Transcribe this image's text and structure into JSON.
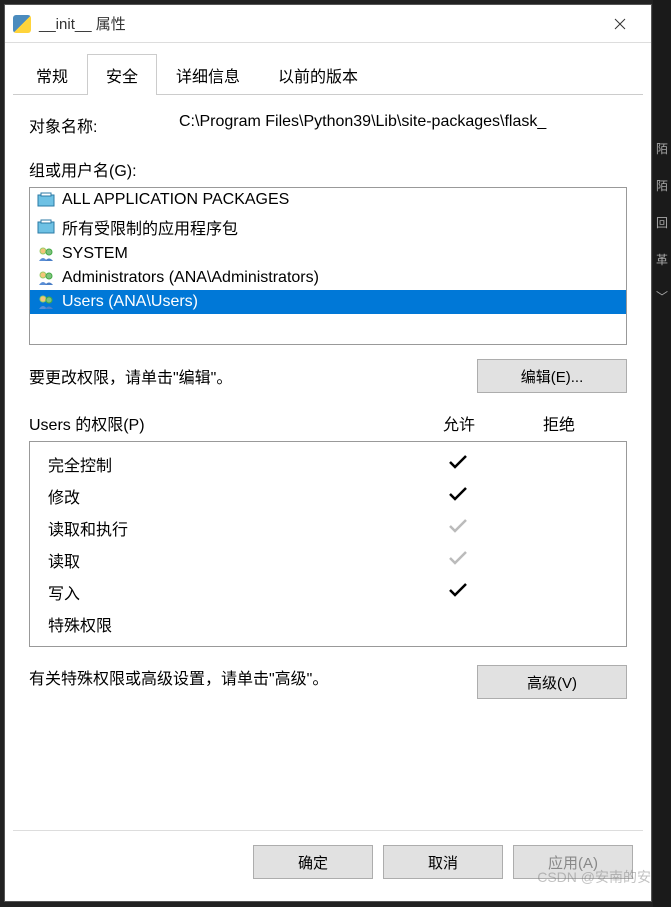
{
  "titlebar": {
    "title": "__init__ 属性"
  },
  "tabs": [
    {
      "label": "常规",
      "active": false
    },
    {
      "label": "安全",
      "active": true
    },
    {
      "label": "详细信息",
      "active": false
    },
    {
      "label": "以前的版本",
      "active": false
    }
  ],
  "object": {
    "label": "对象名称:",
    "path": "C:\\Program Files\\Python39\\Lib\\site-packages\\flask_"
  },
  "groups": {
    "label": "组或用户名(G):",
    "items": [
      {
        "name": "ALL APPLICATION PACKAGES",
        "icon": "package",
        "selected": false
      },
      {
        "name": "所有受限制的应用程序包",
        "icon": "package",
        "selected": false
      },
      {
        "name": "SYSTEM",
        "icon": "users",
        "selected": false
      },
      {
        "name": "Administrators (ANA\\Administrators)",
        "icon": "users",
        "selected": false
      },
      {
        "name": "Users (ANA\\Users)",
        "icon": "users",
        "selected": true
      }
    ]
  },
  "edit": {
    "hint": "要更改权限，请单击\"编辑\"。",
    "button": "编辑(E)..."
  },
  "permissions": {
    "header_for": "Users 的权限(P)",
    "allow_label": "允许",
    "deny_label": "拒绝",
    "items": [
      {
        "name": "完全控制",
        "allow": "black",
        "deny": "none"
      },
      {
        "name": "修改",
        "allow": "black",
        "deny": "none"
      },
      {
        "name": "读取和执行",
        "allow": "grey",
        "deny": "none"
      },
      {
        "name": "读取",
        "allow": "grey",
        "deny": "none"
      },
      {
        "name": "写入",
        "allow": "black",
        "deny": "none"
      },
      {
        "name": "特殊权限",
        "allow": "none",
        "deny": "none"
      }
    ]
  },
  "advanced": {
    "hint": "有关特殊权限或高级设置，请单击\"高级\"。",
    "button": "高级(V)"
  },
  "buttons": {
    "ok": "确定",
    "cancel": "取消",
    "apply": "应用(A)"
  },
  "watermark": "CSDN @安南的安"
}
